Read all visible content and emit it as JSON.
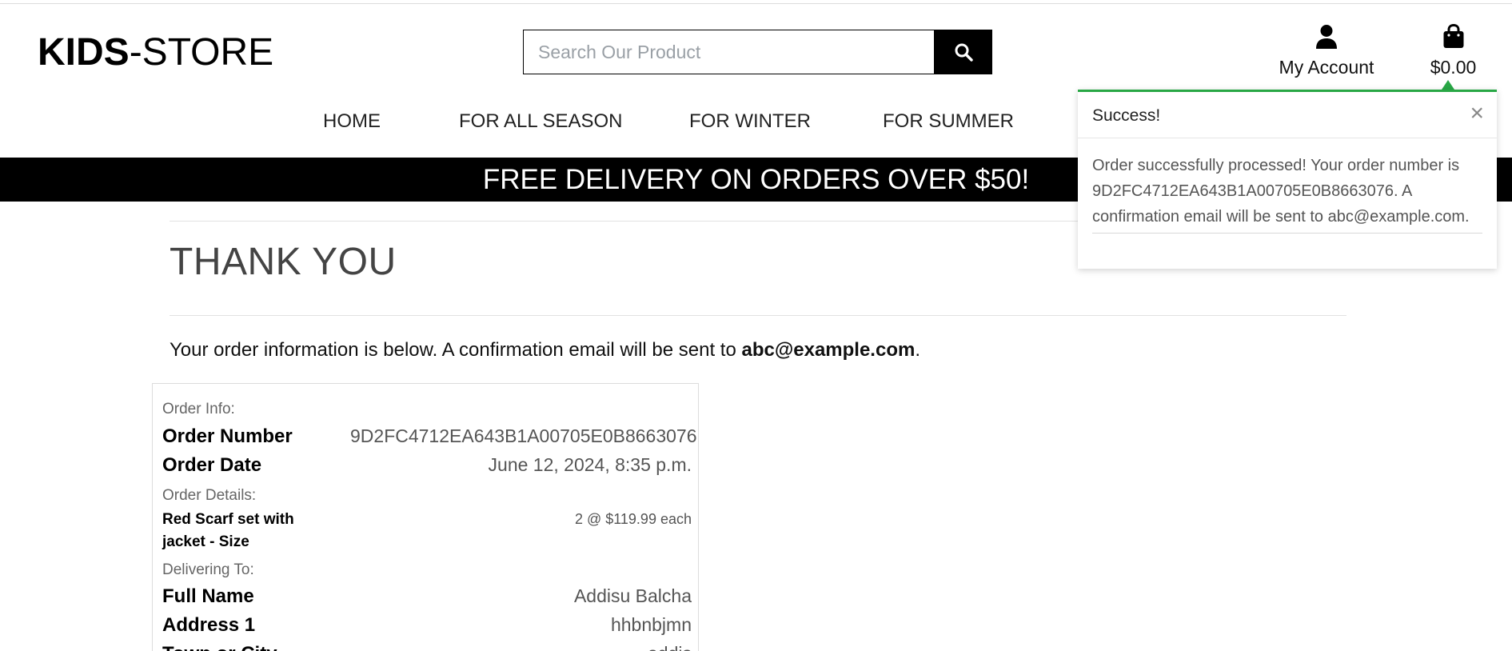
{
  "header": {
    "logo_bold": "KIDS",
    "logo_rest": "-STORE",
    "search_placeholder": "Search Our Product",
    "account_label": "My Account",
    "cart_total": "$0.00"
  },
  "nav": {
    "items": [
      "HOME",
      "FOR ALL SEASON",
      "FOR WINTER",
      "FOR SUMMER"
    ]
  },
  "banner": {
    "text": "FREE DELIVERY ON ORDERS OVER $50!"
  },
  "main": {
    "title": "THANK YOU",
    "intro_text": "Your order information is below. A confirmation email will be sent to ",
    "intro_email": "abc@example.com",
    "intro_end": ".",
    "order_info_heading": "Order Info:",
    "order_number_label": "Order Number",
    "order_number": "9D2FC4712EA643B1A00705E0B8663076",
    "order_date_label": "Order Date",
    "order_date": "June 12, 2024, 8:35 p.m.",
    "order_details_heading": "Order Details:",
    "item_name": "Red Scarf set with jacket - Size",
    "item_qty": "2 @ $119.99 each",
    "delivering_heading": "Delivering To:",
    "full_name_label": "Full Name",
    "full_name": "Addisu Balcha",
    "address1_label": "Address 1",
    "address1": "hhbnbjmn",
    "town_label": "Town or City",
    "town": "addis"
  },
  "toast": {
    "title": "Success!",
    "close": "×",
    "message": "Order successfully processed! Your order number is 9D2FC4712EA643B1A00705E0B8663076. A confirmation email will be sent to abc@example.com."
  },
  "colors": {
    "accent_success": "#28a745",
    "banner_bg": "#000000"
  }
}
